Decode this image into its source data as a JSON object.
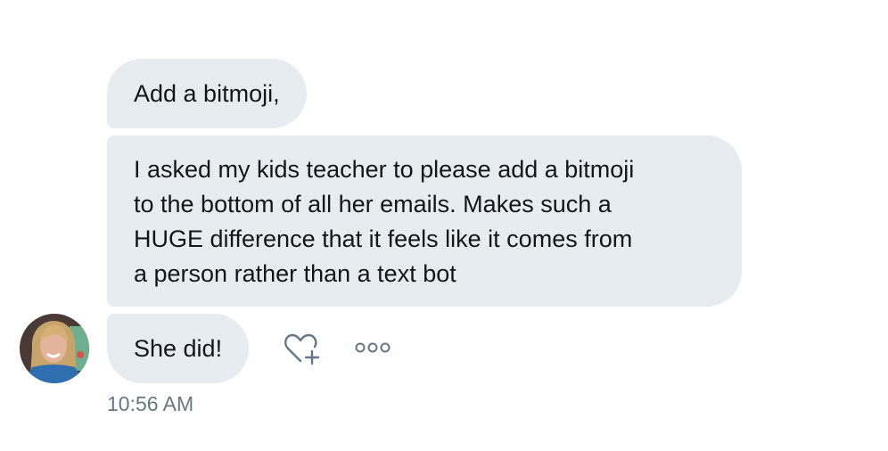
{
  "messages": [
    {
      "text": "Add a bitmoji,"
    },
    {
      "lines": [
        "I asked my kids teacher to please add a bitmoji",
        "to the bottom of all her emails. Makes such a",
        "HUGE difference that it feels like it comes from",
        "a person rather than a text bot"
      ]
    },
    {
      "text": "She did!"
    }
  ],
  "timestamp": "10:56 AM",
  "icons": {
    "like": "heart-plus-icon",
    "more": "more-options-icon"
  },
  "colors": {
    "bubble": "#e6ecf0",
    "text": "#14171a",
    "meta": "#657786"
  }
}
